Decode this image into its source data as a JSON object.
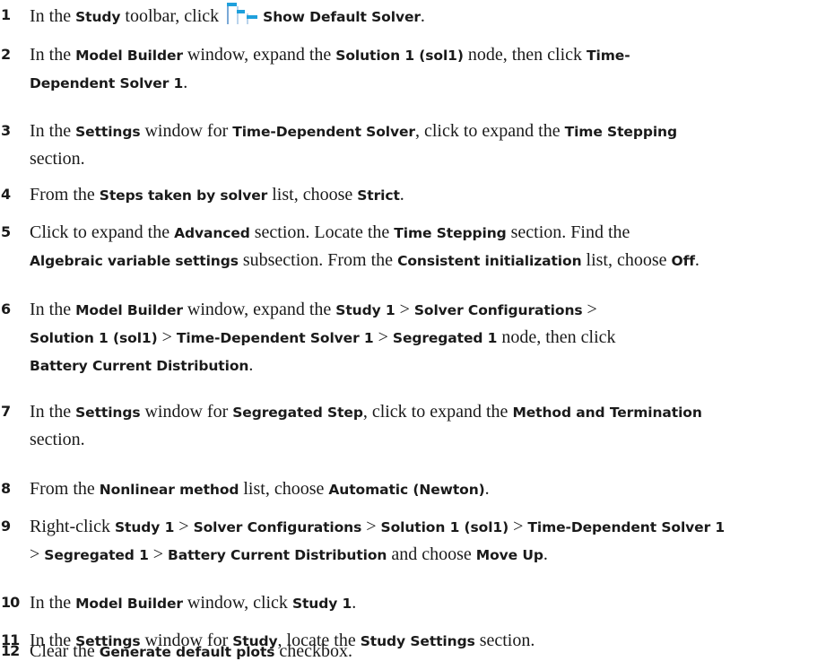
{
  "steps": [
    {
      "num": "1",
      "parts": [
        {
          "t": "In the "
        },
        {
          "t": "Study",
          "b": true
        },
        {
          "t": " toolbar, click "
        },
        {
          "icon": "show-default-solver-icon"
        },
        {
          "t": "Show Default Solver",
          "b": true
        },
        {
          "t": "."
        }
      ]
    },
    {
      "num": "2",
      "parts": [
        {
          "t": "In the "
        },
        {
          "t": "Model Builder",
          "b": true
        },
        {
          "t": " window, expand the "
        },
        {
          "t": "Solution 1 (sol1)",
          "b": true
        },
        {
          "t": " node, then click "
        },
        {
          "t": "Time-",
          "b": true
        },
        {
          "br": true
        },
        {
          "t": "Dependent Solver 1",
          "b": true
        },
        {
          "t": "."
        }
      ]
    },
    {
      "num": "3",
      "parts": [
        {
          "t": "In the "
        },
        {
          "t": "Settings",
          "b": true
        },
        {
          "t": " window for "
        },
        {
          "t": "Time-Dependent Solver",
          "b": true
        },
        {
          "t": ", click to expand the "
        },
        {
          "t": "Time Stepping",
          "b": true
        },
        {
          "br": true
        },
        {
          "t": "section."
        }
      ]
    },
    {
      "num": "4",
      "parts": [
        {
          "t": "From the "
        },
        {
          "t": "Steps taken by solver",
          "b": true
        },
        {
          "t": " list, choose "
        },
        {
          "t": "Strict",
          "b": true
        },
        {
          "t": "."
        }
      ]
    },
    {
      "num": "5",
      "parts": [
        {
          "t": "Click to expand the "
        },
        {
          "t": "Advanced",
          "b": true
        },
        {
          "t": " section. Locate the "
        },
        {
          "t": "Time Stepping",
          "b": true
        },
        {
          "t": " section. Find the"
        },
        {
          "br": true
        },
        {
          "t": "Algebraic variable settings",
          "b": true
        },
        {
          "t": " subsection. From the "
        },
        {
          "t": "Consistent initialization",
          "b": true
        },
        {
          "t": " list, choose "
        },
        {
          "t": "Off",
          "b": true
        },
        {
          "t": "."
        }
      ]
    },
    {
      "num": "6",
      "parts": [
        {
          "t": "In the "
        },
        {
          "t": "Model Builder",
          "b": true
        },
        {
          "t": " window, expand the "
        },
        {
          "t": "Study 1",
          "b": true
        },
        {
          "t": " > "
        },
        {
          "t": "Solver Configurations",
          "b": true
        },
        {
          "t": " >"
        },
        {
          "br": true
        },
        {
          "t": "Solution 1 (sol1)",
          "b": true
        },
        {
          "t": " > "
        },
        {
          "t": "Time-Dependent Solver 1",
          "b": true
        },
        {
          "t": " > "
        },
        {
          "t": "Segregated 1",
          "b": true
        },
        {
          "t": " node, then click"
        },
        {
          "br": true
        },
        {
          "t": "Battery Current Distribution",
          "b": true
        },
        {
          "t": "."
        }
      ]
    },
    {
      "num": "7",
      "parts": [
        {
          "t": "In the "
        },
        {
          "t": "Settings",
          "b": true
        },
        {
          "t": " window for "
        },
        {
          "t": "Segregated Step",
          "b": true
        },
        {
          "t": ", click to expand the "
        },
        {
          "t": "Method and Termination",
          "b": true
        },
        {
          "br": true
        },
        {
          "t": "section."
        }
      ]
    },
    {
      "num": "8",
      "parts": [
        {
          "t": "From the "
        },
        {
          "t": "Nonlinear method",
          "b": true
        },
        {
          "t": " list, choose "
        },
        {
          "t": "Automatic (Newton)",
          "b": true
        },
        {
          "t": "."
        }
      ]
    },
    {
      "num": "9",
      "parts": [
        {
          "t": "Right-click "
        },
        {
          "t": "Study 1",
          "b": true
        },
        {
          "t": " > "
        },
        {
          "t": "Solver Configurations",
          "b": true
        },
        {
          "t": " > "
        },
        {
          "t": "Solution 1 (sol1)",
          "b": true
        },
        {
          "t": " > "
        },
        {
          "t": "Time-Dependent Solver 1",
          "b": true
        },
        {
          "br": true
        },
        {
          "t": "> "
        },
        {
          "t": "Segregated 1",
          "b": true
        },
        {
          "t": " > "
        },
        {
          "t": "Battery Current Distribution",
          "b": true
        },
        {
          "t": " and choose "
        },
        {
          "t": "Move Up",
          "b": true
        },
        {
          "t": "."
        }
      ]
    },
    {
      "num": "10",
      "parts": [
        {
          "t": "In the "
        },
        {
          "t": "Model Builder",
          "b": true
        },
        {
          "t": " window, click "
        },
        {
          "t": "Study 1",
          "b": true
        },
        {
          "t": "."
        }
      ]
    },
    {
      "num": "11",
      "parts": [
        {
          "t": "In the "
        },
        {
          "t": "Settings",
          "b": true
        },
        {
          "t": " window for "
        },
        {
          "t": "Study",
          "b": true
        },
        {
          "t": ", locate the "
        },
        {
          "t": "Study Settings",
          "b": true
        },
        {
          "t": " section."
        }
      ]
    },
    {
      "num": "12",
      "parts": [
        {
          "t": "Clear the "
        },
        {
          "t": "Generate default plots",
          "b": true
        },
        {
          "t": " checkbox."
        }
      ]
    }
  ]
}
